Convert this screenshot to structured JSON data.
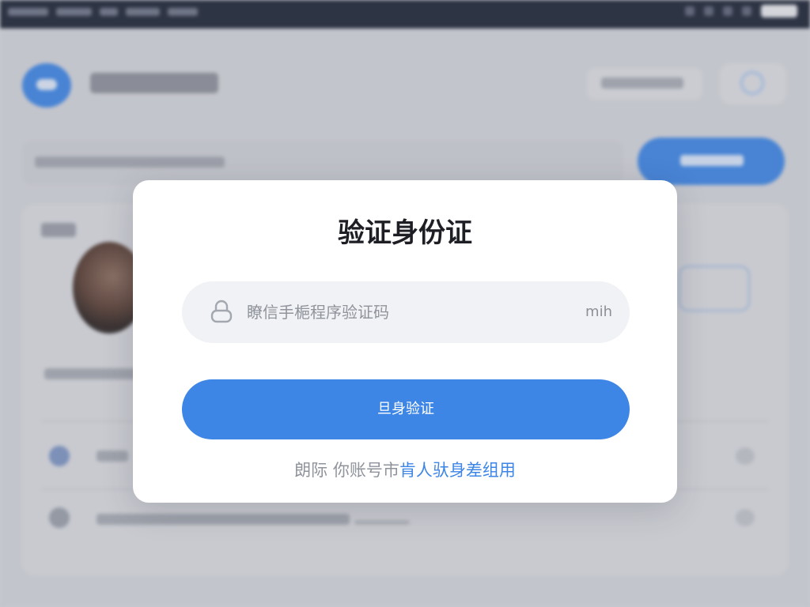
{
  "dialog": {
    "title": "验证身份证",
    "input": {
      "placeholder": "瞭信手梔程序验证码",
      "value": "",
      "suffix": "mih"
    },
    "verify_button_label": "旦身验证",
    "footer": {
      "prefix": "朗际 你账号市",
      "link": "肯人驮身差组用"
    }
  },
  "icons": {
    "input_icon": "lock-icon"
  },
  "colors": {
    "accent": "#3d86e6",
    "modal_background": "#ffffff",
    "input_background": "#f1f2f5",
    "title_text": "#1e1f24",
    "muted_text": "#8f939b"
  }
}
